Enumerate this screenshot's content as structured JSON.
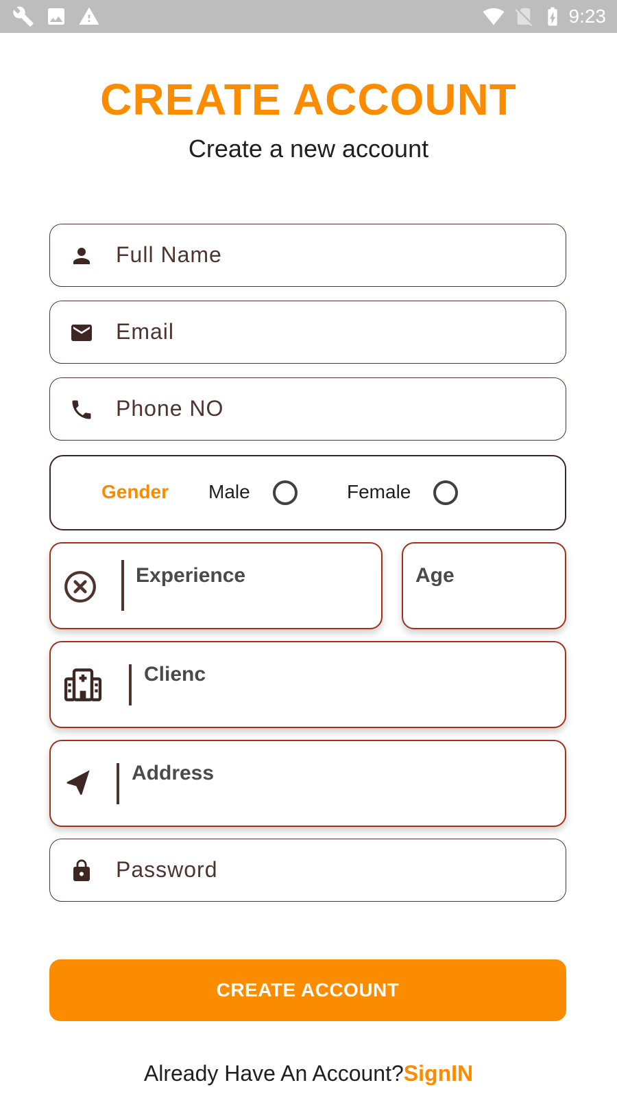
{
  "status_bar": {
    "time": "9:23",
    "left_icons": [
      "wrench-icon",
      "image-icon",
      "warning-icon"
    ],
    "right_icons": [
      "wifi-icon",
      "no-sim-icon",
      "battery-charging-icon"
    ]
  },
  "header": {
    "title": "CREATE ACCOUNT",
    "subtitle": "Create a new account"
  },
  "form": {
    "full_name": {
      "placeholder": "Full Name",
      "icon": "person-icon"
    },
    "email": {
      "placeholder": "Email",
      "icon": "mail-icon"
    },
    "phone": {
      "placeholder": "Phone NO",
      "icon": "phone-icon"
    },
    "gender": {
      "label": "Gender",
      "options": [
        "Male",
        "Female"
      ]
    },
    "experience": {
      "label": "Experience",
      "icon": "cancel-circle-icon"
    },
    "age": {
      "label": "Age"
    },
    "clinic": {
      "label": "Clienc",
      "icon": "hospital-icon"
    },
    "address": {
      "label": "Address",
      "icon": "navigation-arrow-icon"
    },
    "password": {
      "placeholder": "Password",
      "icon": "lock-icon"
    }
  },
  "actions": {
    "create_account_label": "CREATE ACCOUNT"
  },
  "footer": {
    "prompt": "Already Have An Account?",
    "link": "SignIN"
  },
  "colors": {
    "accent": "#fb8c00",
    "text_dark": "#4e342e",
    "card_border": "#a0301a",
    "status_bar": "#bdbdbd"
  }
}
